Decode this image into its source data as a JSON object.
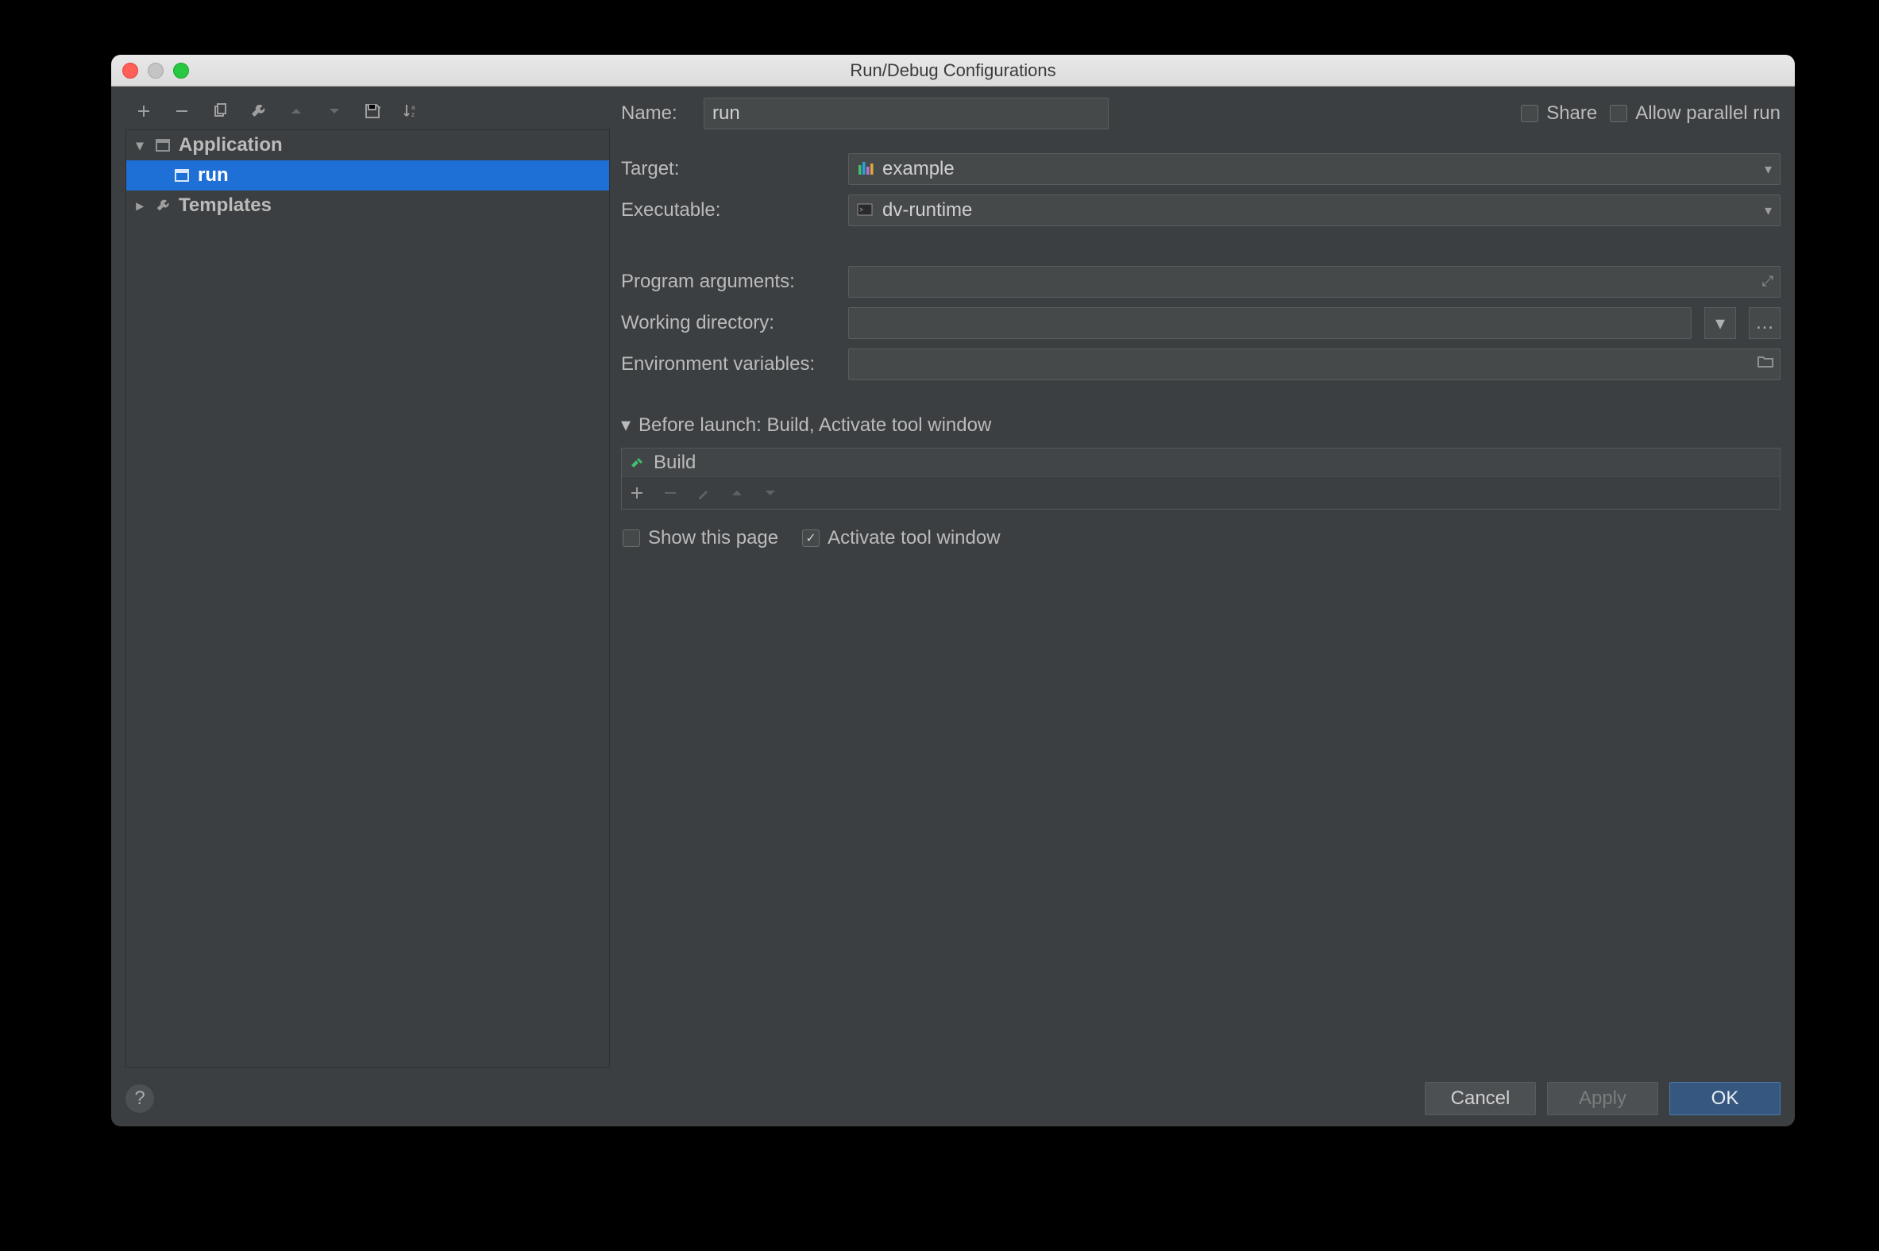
{
  "window": {
    "title": "Run/Debug Configurations"
  },
  "sidebar": {
    "application_label": "Application",
    "run_label": "run",
    "templates_label": "Templates"
  },
  "toolbar": {
    "add": "+",
    "remove": "−",
    "copy": "⧉",
    "wrench": "🔧",
    "up": "▲",
    "down": "▼",
    "save": "floppy",
    "sort": "az"
  },
  "form": {
    "name_label": "Name:",
    "name_value": "run",
    "share_label": "Share",
    "parallel_label": "Allow parallel run",
    "target_label": "Target:",
    "target_value": "example",
    "exec_label": "Executable:",
    "exec_value": "dv-runtime",
    "args_label": "Program arguments:",
    "args_value": "",
    "wd_label": "Working directory:",
    "wd_value": "",
    "env_label": "Environment variables:",
    "env_value": "",
    "before_launch_label": "Before launch: Build, Activate tool window",
    "task_build": "Build",
    "show_page_label": "Show this page",
    "activate_tool_label": "Activate tool window"
  },
  "footer": {
    "cancel": "Cancel",
    "apply": "Apply",
    "ok": "OK"
  }
}
